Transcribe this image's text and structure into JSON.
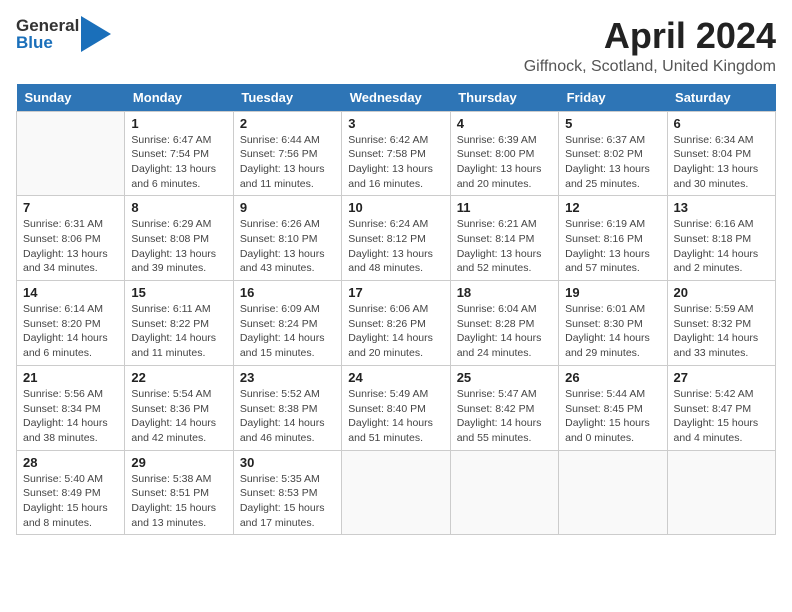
{
  "header": {
    "logo_general": "General",
    "logo_blue": "Blue",
    "month_title": "April 2024",
    "location": "Giffnock, Scotland, United Kingdom"
  },
  "days_of_week": [
    "Sunday",
    "Monday",
    "Tuesday",
    "Wednesday",
    "Thursday",
    "Friday",
    "Saturday"
  ],
  "weeks": [
    [
      {
        "day": "",
        "info": ""
      },
      {
        "day": "1",
        "info": "Sunrise: 6:47 AM\nSunset: 7:54 PM\nDaylight: 13 hours\nand 6 minutes."
      },
      {
        "day": "2",
        "info": "Sunrise: 6:44 AM\nSunset: 7:56 PM\nDaylight: 13 hours\nand 11 minutes."
      },
      {
        "day": "3",
        "info": "Sunrise: 6:42 AM\nSunset: 7:58 PM\nDaylight: 13 hours\nand 16 minutes."
      },
      {
        "day": "4",
        "info": "Sunrise: 6:39 AM\nSunset: 8:00 PM\nDaylight: 13 hours\nand 20 minutes."
      },
      {
        "day": "5",
        "info": "Sunrise: 6:37 AM\nSunset: 8:02 PM\nDaylight: 13 hours\nand 25 minutes."
      },
      {
        "day": "6",
        "info": "Sunrise: 6:34 AM\nSunset: 8:04 PM\nDaylight: 13 hours\nand 30 minutes."
      }
    ],
    [
      {
        "day": "7",
        "info": "Sunrise: 6:31 AM\nSunset: 8:06 PM\nDaylight: 13 hours\nand 34 minutes."
      },
      {
        "day": "8",
        "info": "Sunrise: 6:29 AM\nSunset: 8:08 PM\nDaylight: 13 hours\nand 39 minutes."
      },
      {
        "day": "9",
        "info": "Sunrise: 6:26 AM\nSunset: 8:10 PM\nDaylight: 13 hours\nand 43 minutes."
      },
      {
        "day": "10",
        "info": "Sunrise: 6:24 AM\nSunset: 8:12 PM\nDaylight: 13 hours\nand 48 minutes."
      },
      {
        "day": "11",
        "info": "Sunrise: 6:21 AM\nSunset: 8:14 PM\nDaylight: 13 hours\nand 52 minutes."
      },
      {
        "day": "12",
        "info": "Sunrise: 6:19 AM\nSunset: 8:16 PM\nDaylight: 13 hours\nand 57 minutes."
      },
      {
        "day": "13",
        "info": "Sunrise: 6:16 AM\nSunset: 8:18 PM\nDaylight: 14 hours\nand 2 minutes."
      }
    ],
    [
      {
        "day": "14",
        "info": "Sunrise: 6:14 AM\nSunset: 8:20 PM\nDaylight: 14 hours\nand 6 minutes."
      },
      {
        "day": "15",
        "info": "Sunrise: 6:11 AM\nSunset: 8:22 PM\nDaylight: 14 hours\nand 11 minutes."
      },
      {
        "day": "16",
        "info": "Sunrise: 6:09 AM\nSunset: 8:24 PM\nDaylight: 14 hours\nand 15 minutes."
      },
      {
        "day": "17",
        "info": "Sunrise: 6:06 AM\nSunset: 8:26 PM\nDaylight: 14 hours\nand 20 minutes."
      },
      {
        "day": "18",
        "info": "Sunrise: 6:04 AM\nSunset: 8:28 PM\nDaylight: 14 hours\nand 24 minutes."
      },
      {
        "day": "19",
        "info": "Sunrise: 6:01 AM\nSunset: 8:30 PM\nDaylight: 14 hours\nand 29 minutes."
      },
      {
        "day": "20",
        "info": "Sunrise: 5:59 AM\nSunset: 8:32 PM\nDaylight: 14 hours\nand 33 minutes."
      }
    ],
    [
      {
        "day": "21",
        "info": "Sunrise: 5:56 AM\nSunset: 8:34 PM\nDaylight: 14 hours\nand 38 minutes."
      },
      {
        "day": "22",
        "info": "Sunrise: 5:54 AM\nSunset: 8:36 PM\nDaylight: 14 hours\nand 42 minutes."
      },
      {
        "day": "23",
        "info": "Sunrise: 5:52 AM\nSunset: 8:38 PM\nDaylight: 14 hours\nand 46 minutes."
      },
      {
        "day": "24",
        "info": "Sunrise: 5:49 AM\nSunset: 8:40 PM\nDaylight: 14 hours\nand 51 minutes."
      },
      {
        "day": "25",
        "info": "Sunrise: 5:47 AM\nSunset: 8:42 PM\nDaylight: 14 hours\nand 55 minutes."
      },
      {
        "day": "26",
        "info": "Sunrise: 5:44 AM\nSunset: 8:45 PM\nDaylight: 15 hours\nand 0 minutes."
      },
      {
        "day": "27",
        "info": "Sunrise: 5:42 AM\nSunset: 8:47 PM\nDaylight: 15 hours\nand 4 minutes."
      }
    ],
    [
      {
        "day": "28",
        "info": "Sunrise: 5:40 AM\nSunset: 8:49 PM\nDaylight: 15 hours\nand 8 minutes."
      },
      {
        "day": "29",
        "info": "Sunrise: 5:38 AM\nSunset: 8:51 PM\nDaylight: 15 hours\nand 13 minutes."
      },
      {
        "day": "30",
        "info": "Sunrise: 5:35 AM\nSunset: 8:53 PM\nDaylight: 15 hours\nand 17 minutes."
      },
      {
        "day": "",
        "info": ""
      },
      {
        "day": "",
        "info": ""
      },
      {
        "day": "",
        "info": ""
      },
      {
        "day": "",
        "info": ""
      }
    ]
  ]
}
